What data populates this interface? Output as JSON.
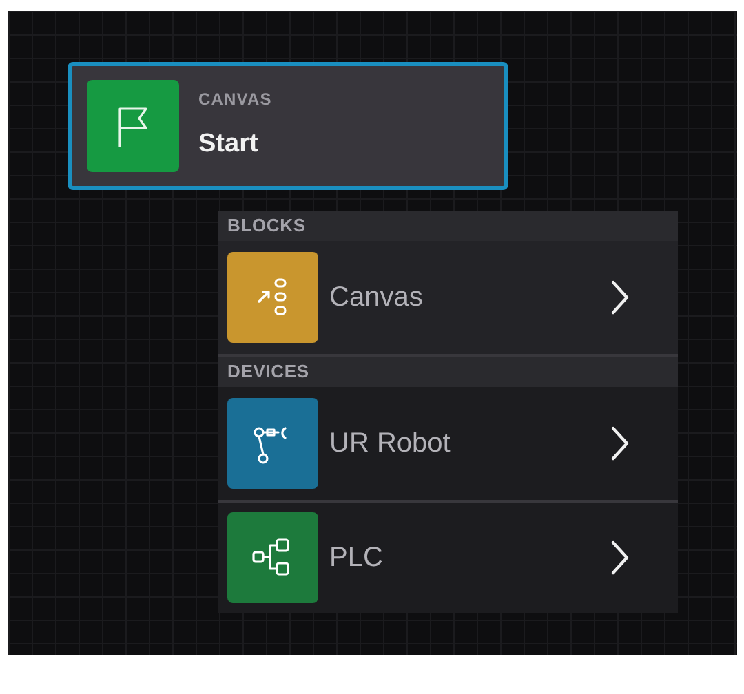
{
  "start_node": {
    "category": "CANVAS",
    "title": "Start",
    "selected": true,
    "color": "#169a42"
  },
  "menu": {
    "sections": [
      {
        "heading": "BLOCKS",
        "items": [
          {
            "label": "Canvas",
            "kind": "blocks",
            "color": "#c9962e"
          }
        ]
      },
      {
        "heading": "DEVICES",
        "items": [
          {
            "label": "UR Robot",
            "kind": "robot",
            "color": "#1a6f96"
          },
          {
            "label": "PLC",
            "kind": "plc",
            "color": "#1d7a3c"
          }
        ]
      }
    ]
  }
}
